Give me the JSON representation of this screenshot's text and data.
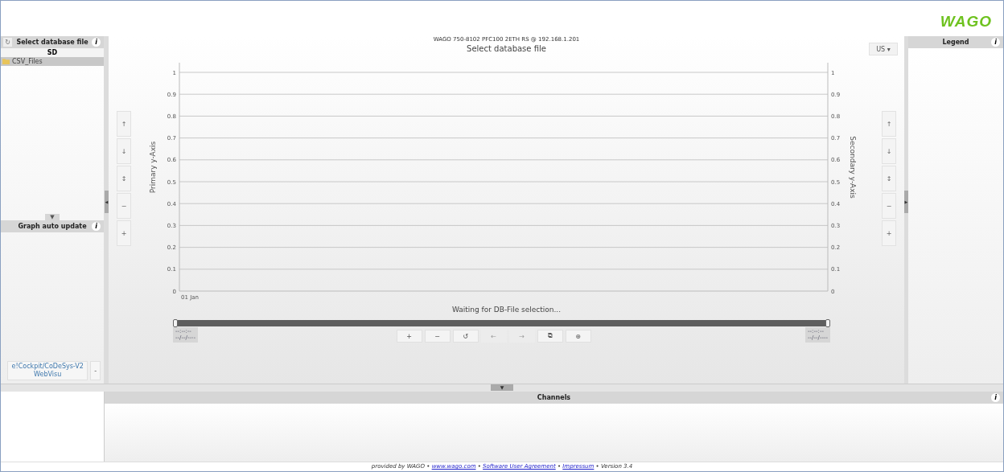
{
  "header": {
    "logo": "WAGO",
    "device": "WAGO 750-8102 PFC100 2ETH RS @ 192.168.1.201"
  },
  "file_panel": {
    "refresh": "↻",
    "title": "Select database file",
    "info": "i",
    "group": "SD",
    "items": [
      {
        "label": "CSV_Files",
        "selected": true
      }
    ],
    "collapse": "▼"
  },
  "auto_update_panel": {
    "title": "Graph auto update",
    "info": "i",
    "visu_button": "e!Cockpit/CoDeSys-V2 WebVisu",
    "visu_menu": "-"
  },
  "left_toggle": "◀",
  "right_toggle": "▶",
  "bottom_toggle": "▼",
  "chart": {
    "title": "Select database file",
    "unit_dropdown": "US",
    "unit_caret": "▾",
    "status": "Waiting for DB-File selection...",
    "left_buttons": [
      "↑",
      "↓",
      "↕",
      "−",
      "+"
    ],
    "right_buttons": [
      "↑",
      "↓",
      "↕",
      "−",
      "+"
    ],
    "secondary_ylabel": "Secondary y-Axis",
    "secondary_yticks": [
      "1",
      "0.9",
      "0.8",
      "0.7",
      "0.6",
      "0.5",
      "0.4",
      "0.3",
      "0.2",
      "0.1",
      "0"
    ],
    "x_start_label": "01 Jan",
    "primary_ylabel": "Primary y-Axis",
    "primary_yticks": [
      "1",
      "0.9",
      "0.8",
      "0.7",
      "0.6",
      "0.5",
      "0.4",
      "0.3",
      "0.2",
      "0.1",
      "0"
    ],
    "range": {
      "level": 1,
      "start_time": "--:--:--",
      "start_date": "--/--/----",
      "end_time": "--:--:--",
      "end_date": "--/--/----"
    },
    "toolbar": [
      {
        "label": "+",
        "disabled": false
      },
      {
        "label": "−",
        "disabled": false
      },
      {
        "label": "↺",
        "disabled": false
      },
      {
        "label": "←",
        "disabled": true
      },
      {
        "label": "→",
        "disabled": true
      },
      {
        "label": "⧉",
        "disabled": false
      },
      {
        "label": "⊕",
        "disabled": false
      }
    ]
  },
  "legend": {
    "title": "Legend",
    "info": "i"
  },
  "channels": {
    "title": "Channels",
    "info": "i"
  },
  "footer": [
    {
      "kind": "text",
      "text": "provided by WAGO •"
    },
    {
      "kind": "link",
      "text": "www.wago.com"
    },
    {
      "kind": "text",
      "text": "•"
    },
    {
      "kind": "link",
      "text": "Software User Agreement"
    },
    {
      "kind": "text",
      "text": "•"
    },
    {
      "kind": "link",
      "text": "Impressum"
    },
    {
      "kind": "text",
      "text": "• Version 3.4"
    }
  ]
}
